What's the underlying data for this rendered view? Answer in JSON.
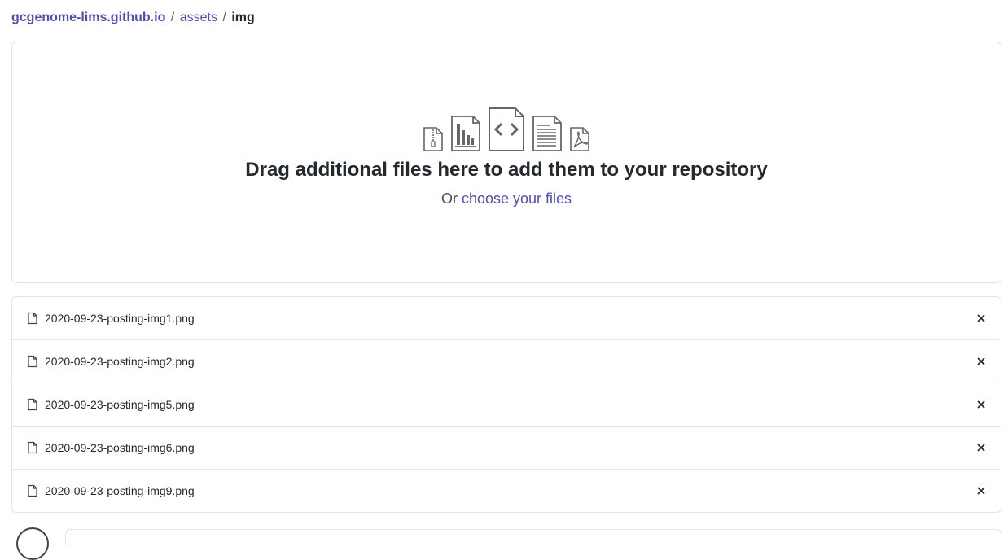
{
  "breadcrumb": {
    "repo": "gcgenome-lims.github.io",
    "separator": "/",
    "folder": "assets",
    "current": "img"
  },
  "dropzone": {
    "icons": [
      "zip-file-icon",
      "chart-file-icon",
      "code-file-icon",
      "text-file-icon",
      "pdf-file-icon"
    ],
    "title": "Drag additional files here to add them to your repository",
    "sub_prefix": "Or",
    "sub_link": "choose your files"
  },
  "files": [
    {
      "name": "2020-09-23-posting-img1.png"
    },
    {
      "name": "2020-09-23-posting-img2.png"
    },
    {
      "name": "2020-09-23-posting-img5.png"
    },
    {
      "name": "2020-09-23-posting-img6.png"
    },
    {
      "name": "2020-09-23-posting-img9.png"
    }
  ],
  "colors": {
    "link": "#4f4fb3",
    "border": "#e1e4e8",
    "text": "#24292e"
  }
}
